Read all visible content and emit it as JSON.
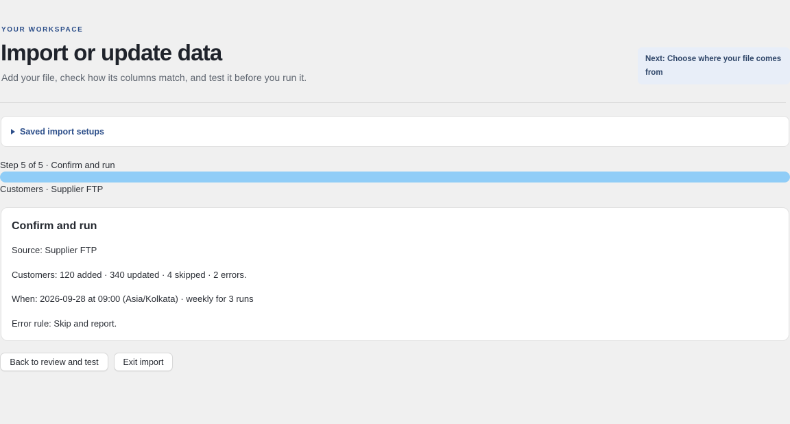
{
  "header": {
    "eyebrow": "YOUR WORKSPACE",
    "title": "Import or update data",
    "subtitle": "Add your file, check how its columns match, and test it before you run it."
  },
  "next_hint": "Next: Choose where your file comes from",
  "saved_setups": {
    "label": "Saved import setups",
    "icon": "triangle-right-icon"
  },
  "progress": {
    "step_label": "Step 5 of 5 · Confirm and run",
    "current_step": 5,
    "total_steps": 5,
    "context": "Customers · Supplier FTP"
  },
  "confirm": {
    "title": "Confirm and run",
    "lines": [
      "Source: Supplier FTP",
      "Customers: 120 added · 340 updated · 4 skipped · 2 errors.",
      "When: 2026-09-28 at 09:00 (Asia/Kolkata) · weekly for 3 runs",
      "Error rule: Skip and report."
    ]
  },
  "actions": {
    "back_label": "Back to review and test",
    "exit_label": "Exit import"
  },
  "colors": {
    "accent": "#2d4f8a",
    "progress_fill": "#90cdf7",
    "background": "#f0f0f0"
  }
}
